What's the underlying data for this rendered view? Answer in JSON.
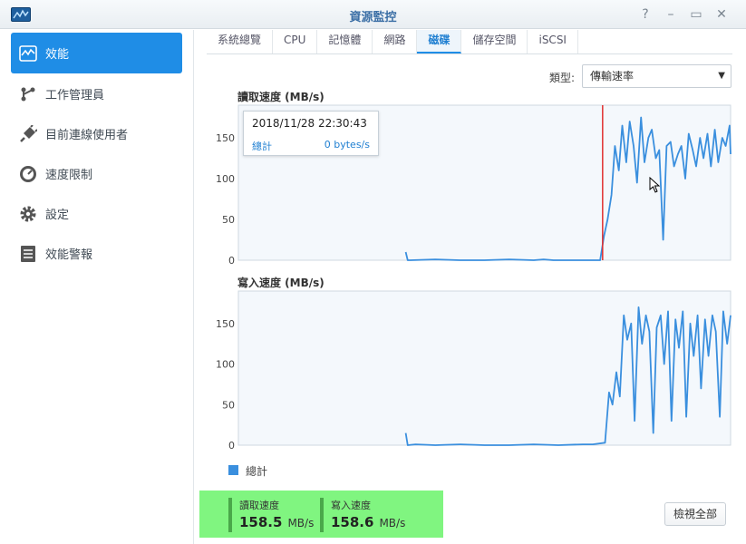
{
  "window": {
    "title": "資源監控",
    "buttons": [
      "?",
      "–",
      "▭",
      "✕"
    ]
  },
  "sidebar": {
    "items": [
      {
        "label": "效能",
        "icon": "performance-chart-icon",
        "active": true
      },
      {
        "label": "工作管理員",
        "icon": "task-manager-icon"
      },
      {
        "label": "目前連線使用者",
        "icon": "plug-icon"
      },
      {
        "label": "速度限制",
        "icon": "speed-gauge-icon"
      },
      {
        "label": "設定",
        "icon": "gear-icon"
      },
      {
        "label": "效能警報",
        "icon": "alert-list-icon"
      }
    ]
  },
  "tabs": [
    {
      "label": "系統總覽"
    },
    {
      "label": "CPU"
    },
    {
      "label": "記憶體"
    },
    {
      "label": "網路"
    },
    {
      "label": "磁碟",
      "active": true
    },
    {
      "label": "儲存空間"
    },
    {
      "label": "iSCSI"
    }
  ],
  "type_filter": {
    "label": "類型:",
    "value": "傳輸速率"
  },
  "tooltip": {
    "time": "2018/11/28 22:30:43",
    "series": "總計",
    "value": "0 bytes/s"
  },
  "legend": {
    "label": "總計"
  },
  "summary": {
    "read_label": "讀取速度",
    "read_value": "158.5",
    "read_unit": "MB/s",
    "write_label": "寫入速度",
    "write_value": "158.6",
    "write_unit": "MB/s"
  },
  "view_all_label": "檢視全部",
  "colors": {
    "accent": "#1f8de6",
    "series": "#3a8fde",
    "marker": "#e03030",
    "summary_bg": "#80f580"
  },
  "chart_data": [
    {
      "type": "line",
      "title": "讀取速度 (MB/s)",
      "ylim": [
        0,
        190
      ],
      "yticks": [
        0,
        50,
        100,
        150
      ],
      "x_range": [
        0,
        100
      ],
      "grid": false,
      "series": [
        {
          "name": "總計",
          "x": [
            34,
            34.4,
            35,
            40,
            45,
            50,
            55,
            60,
            62,
            64,
            65.5,
            66.5,
            67.5,
            68.5,
            69.5,
            70.5,
            71.3,
            72,
            72.8,
            73.5,
            74.3,
            75,
            75.8,
            76.5,
            77.3,
            78,
            78.8,
            79.5,
            80.3,
            81,
            81.8,
            82.5,
            83.3,
            84,
            84.8,
            85.5,
            86.3,
            87,
            87.8,
            88.5,
            89.3,
            90,
            90.8,
            91.5,
            92.3,
            93,
            93.8,
            94.5,
            95.3,
            96,
            96.8,
            97.5,
            98.3,
            99,
            99.8,
            100
          ],
          "values": [
            10,
            0,
            0,
            1,
            0,
            0,
            1,
            0,
            1,
            0,
            0,
            0,
            0,
            0,
            0,
            0,
            0,
            0,
            0,
            0,
            30,
            50,
            80,
            140,
            110,
            165,
            120,
            170,
            140,
            95,
            175,
            120,
            150,
            160,
            125,
            135,
            25,
            140,
            145,
            115,
            130,
            140,
            100,
            155,
            135,
            115,
            150,
            125,
            155,
            115,
            160,
            120,
            150,
            140,
            165,
            130
          ],
          "marker_x": 74
        }
      ]
    },
    {
      "type": "line",
      "title": "寫入速度 (MB/s)",
      "ylim": [
        0,
        190
      ],
      "yticks": [
        0,
        50,
        100,
        150
      ],
      "x_range": [
        0,
        100
      ],
      "grid": false,
      "series": [
        {
          "name": "總計",
          "x": [
            34,
            34.4,
            36,
            40,
            45,
            50,
            55,
            60,
            65,
            70,
            72,
            74.5,
            75.3,
            76,
            76.8,
            77.5,
            78.3,
            79,
            79.8,
            80.5,
            81.3,
            82,
            82.8,
            83.5,
            84.3,
            85,
            85.8,
            86.5,
            87.3,
            88,
            88.8,
            89.5,
            90.3,
            91,
            91.8,
            92.5,
            93.3,
            94,
            94.8,
            95.5,
            96.3,
            97,
            97.8,
            98.5,
            99.3,
            100
          ],
          "values": [
            15,
            0,
            1,
            0,
            1,
            0,
            0,
            1,
            0,
            1,
            1,
            3,
            65,
            50,
            90,
            60,
            160,
            130,
            150,
            30,
            170,
            125,
            160,
            140,
            15,
            145,
            160,
            100,
            165,
            30,
            155,
            120,
            165,
            35,
            150,
            110,
            160,
            70,
            155,
            110,
            160,
            140,
            35,
            165,
            125,
            160
          ]
        }
      ]
    }
  ]
}
